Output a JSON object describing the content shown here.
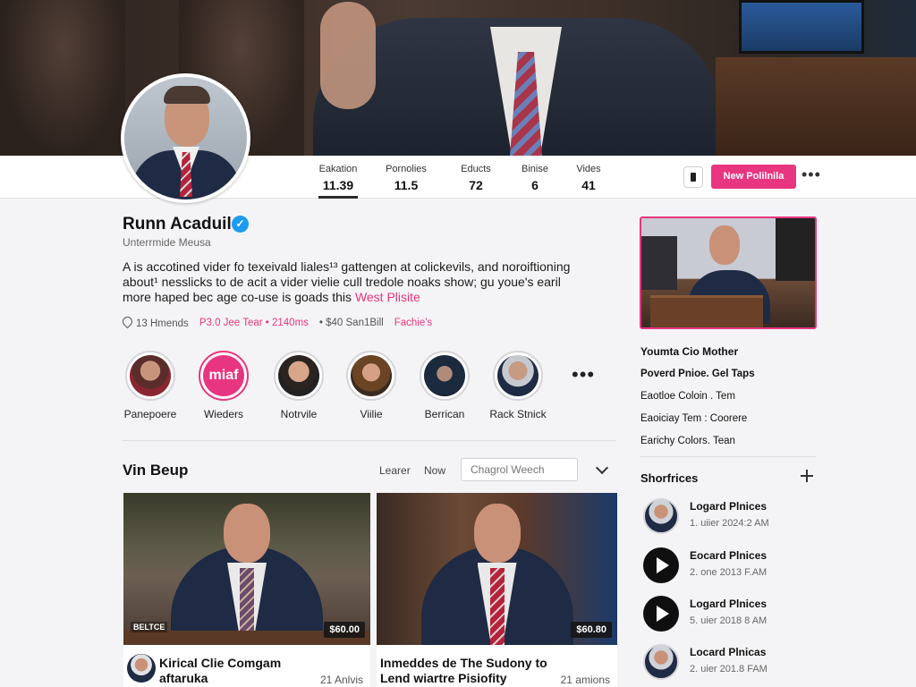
{
  "profile": {
    "name": "Runn Acaduil",
    "handle": "Unterrmide Meusa",
    "bio_text": "A is accotined vider fo texeivald liales¹³ gattengen at colickevils, and noroiftioning about¹ nesslicks to de acit a vider vielie cull tredole noaks show; gu youe's earil more haped bec age co-use is goads this ",
    "bio_link": "West Plisite",
    "location": "13 Hmends",
    "meta_pink": "P3.0 Jee Tear • 2140ms",
    "meta_muted": "• $40 San1Bill",
    "meta_pink2": "Fachie's"
  },
  "stats": [
    {
      "label": "Eakation",
      "value": "11.39"
    },
    {
      "label": "Pornolies",
      "value": "11.5"
    },
    {
      "label": "Educts",
      "value": "72"
    },
    {
      "label": "Binise",
      "value": "6"
    },
    {
      "label": "Vides",
      "value": "41"
    }
  ],
  "header": {
    "primary_button": "New Polilnila",
    "more": "•••"
  },
  "stories": [
    {
      "label": "Panepoere"
    },
    {
      "label": "Wieders",
      "badge": "miaf"
    },
    {
      "label": "Notrvile"
    },
    {
      "label": "Viilie"
    },
    {
      "label": "Berrican"
    },
    {
      "label": "Rack Stnick"
    }
  ],
  "stories_more": "•••",
  "section": {
    "title": "Vin Beup",
    "link1": "Learer",
    "link2": "Now",
    "search_placeholder": "Chagrol Weech"
  },
  "videos": [
    {
      "title": "Kirical Clie Comgam aftaruka",
      "duration": "$60.00",
      "stat": "21 Anlvis",
      "logo": "BELTCE"
    },
    {
      "title": "Inmeddes de The Sudony to Lend wiartre Pisiofity",
      "duration": "$60.80",
      "stat": "21 amions"
    }
  ],
  "right_list": [
    "Youmta Cio Mother",
    "Poverd Pnioe. Gel Taps",
    "Eaotloe Coloin . Tem",
    "Eaoiciay Tem : Coorere",
    "Earichy Colors. Tean"
  ],
  "shorts": {
    "title": "Shorfrices",
    "items": [
      {
        "title": "Logard Plnices",
        "date": "1. uiier 2024:2 AM"
      },
      {
        "title": "Eocard Plnices",
        "date": "2. one 2013 F.AM"
      },
      {
        "title": "Logard Plnices",
        "date": "5. uier 2018 8 AM"
      },
      {
        "title": "Locard Plnicas",
        "date": "2. uier 201.8 FAM"
      }
    ]
  },
  "colors": {
    "accent": "#e8357f",
    "verified": "#1d9bf0"
  }
}
